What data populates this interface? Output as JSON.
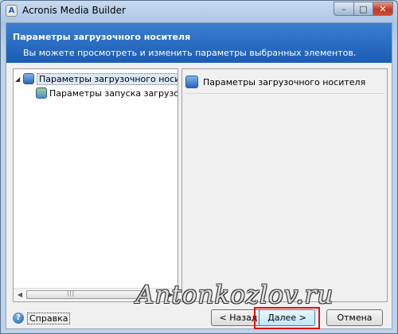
{
  "window": {
    "title": "Acronis Media Builder",
    "app_icon": "A",
    "controls": {
      "minimize": "–",
      "maximize": "□",
      "close": "✕"
    }
  },
  "header": {
    "title": "Параметры загрузочного носителя",
    "subtitle": "Вы можете просмотреть и изменить параметры выбранных элементов."
  },
  "tree": {
    "root": {
      "expander": "◢",
      "icon": "media-options-icon",
      "label": "Параметры загрузочного носителя"
    },
    "child": {
      "icon": "boot-params-icon",
      "label": "Параметры запуска загрузочного н"
    }
  },
  "scrollbar": {
    "left_arrow": "◀",
    "right_arrow": "▶",
    "grip": "|||"
  },
  "panel": {
    "title": "Параметры загрузочного носителя"
  },
  "footer": {
    "help_icon_glyph": "?",
    "help_label": "Справка",
    "back_label": "< Назад",
    "next_label": "Далее >",
    "cancel_label": "Отмена"
  },
  "watermark": "Antonkozlov.ru",
  "colors": {
    "header_blue": "#1c5cb4",
    "highlight_red": "#e20e0e"
  }
}
